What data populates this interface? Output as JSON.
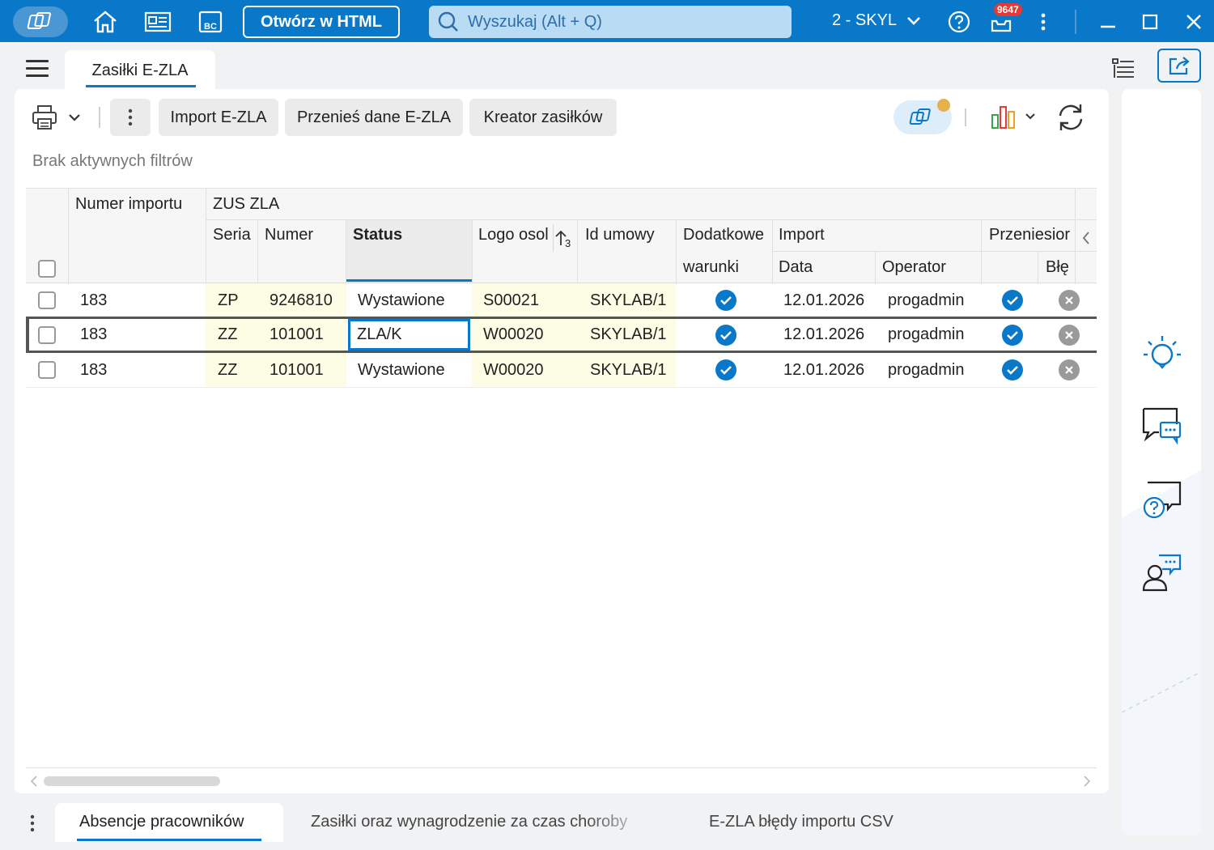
{
  "titlebar": {
    "open_html_label": "Otwórz w HTML",
    "search_placeholder": "Wyszukaj (Alt + Q)",
    "company": "2 - SKYL",
    "notifications_count": "9647"
  },
  "tabs": {
    "active_document": "Zasiłki E-ZLA"
  },
  "toolbar": {
    "import_label": "Import E-ZLA",
    "transfer_label": "Przenieś dane E-ZLA",
    "wizard_label": "Kreator zasiłków"
  },
  "filters_text": "Brak aktywnych filtrów",
  "grid": {
    "headers": {
      "numer_importu": "Numer importu",
      "zus_zla": "ZUS ZLA",
      "seria": "Seria",
      "numer": "Numer",
      "status": "Status",
      "logo": "Logo osol",
      "sort_index": "3",
      "id_umowy": "Id umowy",
      "dodatkowe": "Dodatkowe",
      "warunki": "warunki",
      "import": "Import",
      "data": "Data",
      "operator": "Operator",
      "przeniesione": "Przeniesior",
      "bledy": "Błę"
    },
    "rows": [
      {
        "numer_importu": "183",
        "seria": "ZP",
        "numer": "9246810",
        "status": "Wystawione",
        "logo": "S00021",
        "id_umowy": "SKYLAB/1",
        "data": "12.01.2026",
        "operator": "progadmin"
      },
      {
        "numer_importu": "183",
        "seria": "ZZ",
        "numer": "101001",
        "status": "ZLA/K",
        "logo": "W00020",
        "id_umowy": "SKYLAB/1",
        "data": "12.01.2026",
        "operator": "progadmin"
      },
      {
        "numer_importu": "183",
        "seria": "ZZ",
        "numer": "101001",
        "status": "Wystawione",
        "logo": "W00020",
        "id_umowy": "SKYLAB/1",
        "data": "12.01.2026",
        "operator": "progadmin"
      }
    ]
  },
  "bottom_tabs": {
    "tab1": "Absencje pracowników",
    "tab2": "Zasiłki oraz wynagrodzenie za czas choroby",
    "tab3": "E-ZLA błędy importu CSV"
  },
  "colors": {
    "accent": "#0a78c8",
    "yellow_cell": "#fdfde6"
  }
}
